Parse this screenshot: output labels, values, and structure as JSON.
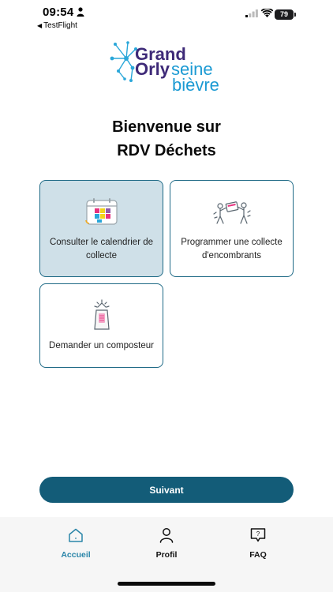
{
  "status_bar": {
    "time": "09:54",
    "back_app": "TestFlight",
    "battery": "79"
  },
  "logo": {
    "line1": "Grand",
    "line2a": "Orly",
    "line2b": "seine",
    "line3": "bièvre"
  },
  "welcome": {
    "line1": "Bienvenue sur",
    "line2": "RDV Déchets"
  },
  "cards": [
    {
      "label": "Consulter le calendrier de collecte",
      "icon": "calendar-icon",
      "selected": true
    },
    {
      "label": "Programmer une collecte d'encombrants",
      "icon": "moving-people-icon",
      "selected": false
    },
    {
      "label": "Demander un composteur",
      "icon": "composter-icon",
      "selected": false
    }
  ],
  "next_button": {
    "label": "Suivant"
  },
  "tab_bar": {
    "home": "Accueil",
    "profile": "Profil",
    "faq": "FAQ"
  },
  "colors": {
    "primary": "#135c78",
    "card_border": "#1f6a86",
    "selected_card": "#cfe0e8",
    "active_tab": "#2a85a8",
    "logo_purple": "#3e2a78",
    "logo_blue": "#1b9ad3"
  }
}
